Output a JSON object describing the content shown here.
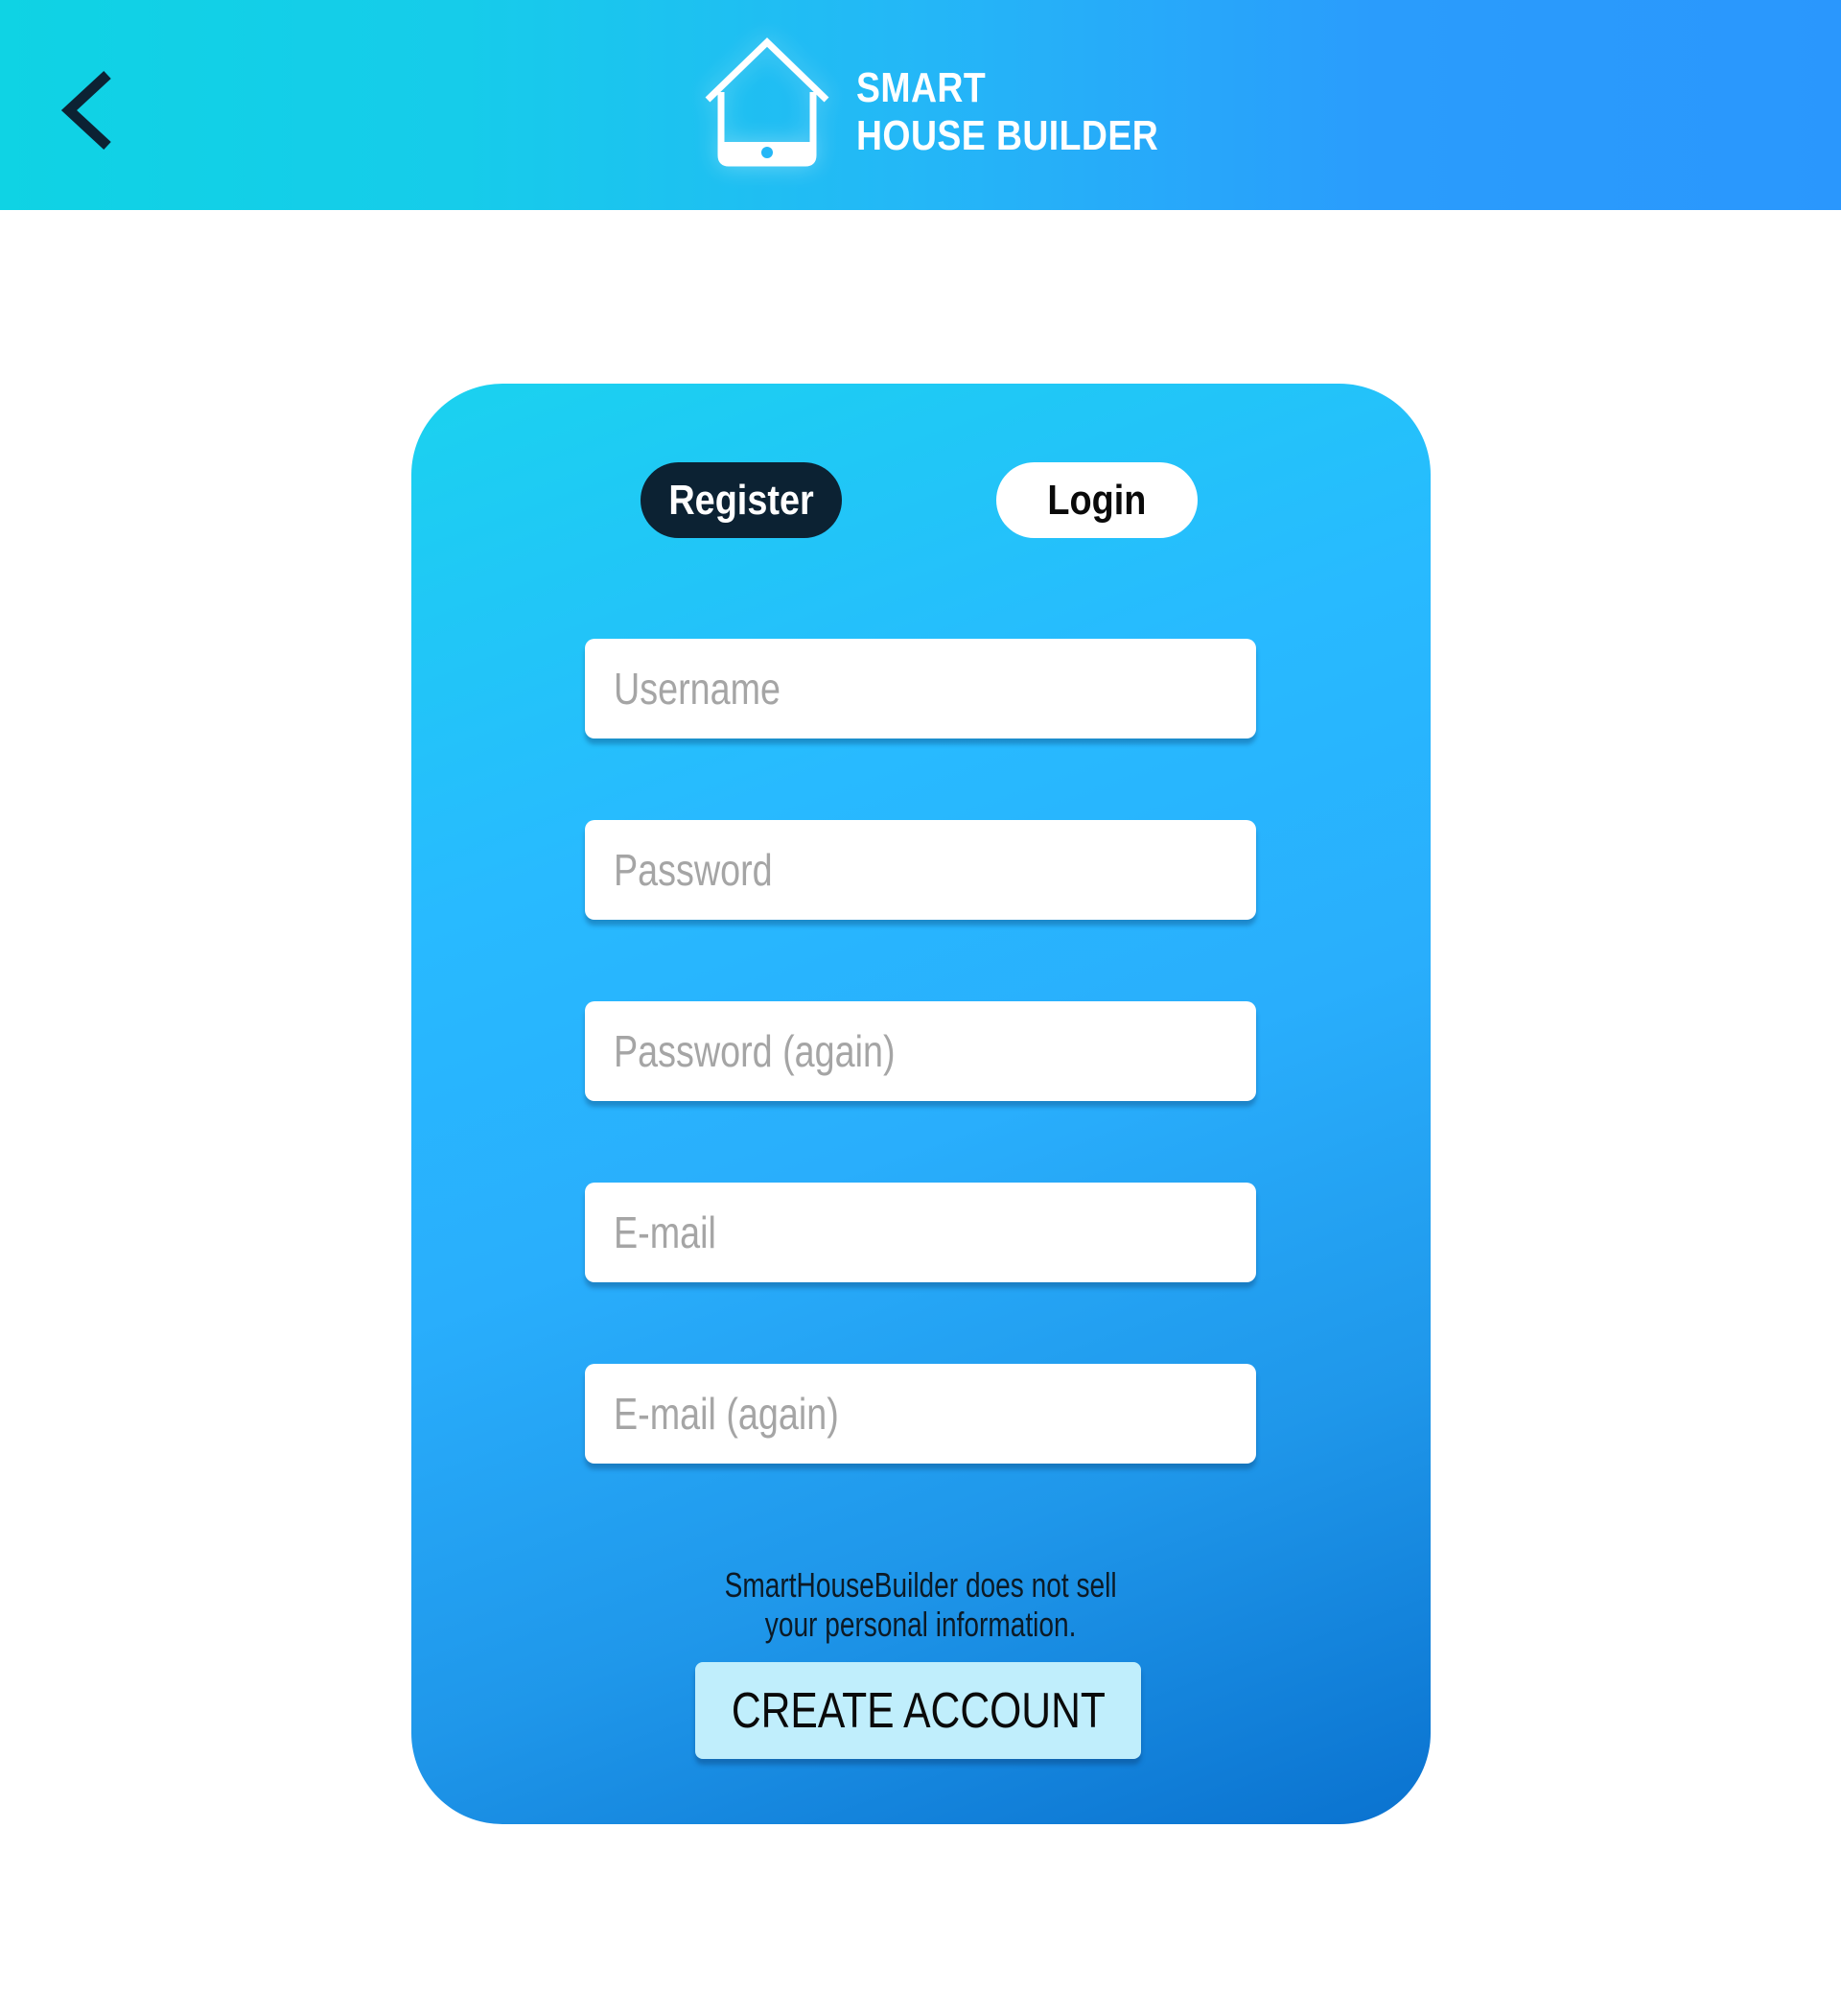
{
  "header": {
    "back_icon": "chevron-left-icon",
    "logo_icon": "house-tablet-icon",
    "brand_line1": "SMART",
    "brand_line2": "HOUSE BUILDER"
  },
  "tabs": [
    {
      "label": "Register",
      "active": true
    },
    {
      "label": "Login",
      "active": false
    }
  ],
  "form": {
    "username_placeholder": "Username",
    "password_placeholder": "Password",
    "password_again_placeholder": "Password (again)",
    "email_placeholder": "E-mail",
    "email_again_placeholder": "E-mail (again)"
  },
  "disclaimer": {
    "line1": "SmartHouseBuilder does not sell",
    "line2": "your personal information."
  },
  "create_button_label": "CREATE ACCOUNT",
  "colors": {
    "header_start": "#0fd3e4",
    "header_end": "#2a97fd",
    "card_start": "#1ad2ef",
    "card_end": "#0a72cf",
    "active_tab": "#0c2233",
    "create_button": "#c0eefc"
  }
}
